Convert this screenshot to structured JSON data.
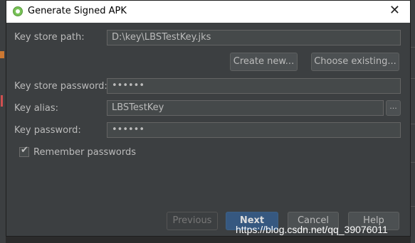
{
  "window": {
    "title": "Generate Signed APK",
    "close_glyph": "✕"
  },
  "form": {
    "key_store_path": {
      "label": "Key store path:",
      "value": "D:\\key\\LBSTestKey.jks"
    },
    "create_new_label": "Create new...",
    "choose_existing_label": "Choose existing...",
    "key_store_password": {
      "label": "Key store password:",
      "value": "••••••"
    },
    "key_alias": {
      "label": "Key alias:",
      "value": "LBSTestKey",
      "browse_label": "..."
    },
    "key_password": {
      "label": "Key password:",
      "value": "••••••"
    },
    "remember": {
      "label": "Remember passwords",
      "checked": true
    }
  },
  "footer": {
    "previous_label": "Previous",
    "next_label": "Next",
    "cancel_label": "Cancel",
    "help_label": "Help"
  },
  "watermark": "https://blog.csdn.net/qq_39076011"
}
